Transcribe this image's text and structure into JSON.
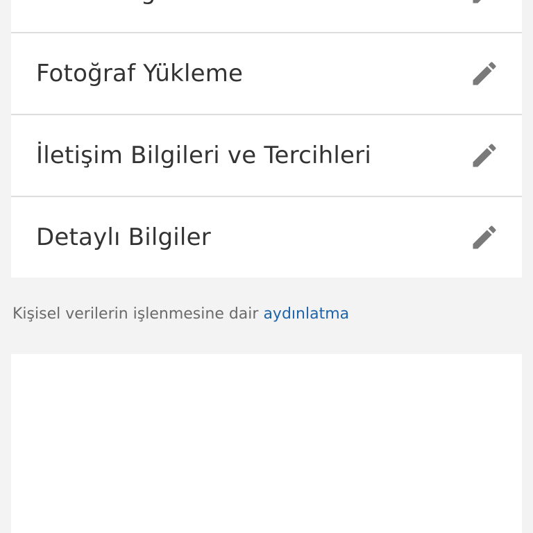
{
  "menu": {
    "items": [
      {
        "label": "Adres Bilgileri",
        "icon": "pencil-icon"
      },
      {
        "label": "Fotoğraf Yükleme",
        "icon": "pencil-icon"
      },
      {
        "label": "İletişim Bilgileri ve Tercihleri",
        "icon": "pencil-icon"
      },
      {
        "label": "Detaylı Bilgiler",
        "icon": "pencil-icon"
      }
    ]
  },
  "footer": {
    "prefix_text": "Kişisel verilerin işlenmesine dair",
    "link_text": "aydınlatma"
  },
  "colors": {
    "text": "#333333",
    "divider": "#dddddd",
    "icon": "#7a7a7a",
    "link": "#1f63a8",
    "muted_text": "#6a6a6a",
    "background": "#f3f3f3"
  }
}
